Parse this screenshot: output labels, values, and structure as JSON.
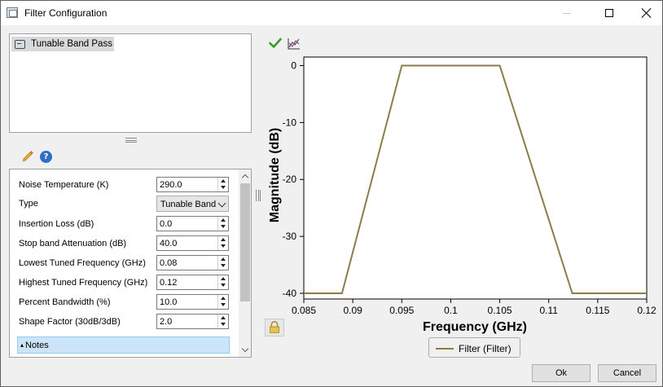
{
  "window": {
    "title": "Filter Configuration"
  },
  "filter_list": {
    "items": [
      {
        "label": "Tunable Band Pass",
        "icon": "filter-icon"
      }
    ]
  },
  "toolbar": {
    "edit_icon": "pencil-icon",
    "help_icon": "help-icon",
    "help_glyph": "?"
  },
  "properties": [
    {
      "label": "Noise Temperature (K)",
      "kind": "spin",
      "value": "290.0"
    },
    {
      "label": "Type",
      "kind": "combo",
      "value": "Tunable Band Pass"
    },
    {
      "label": "Insertion Loss (dB)",
      "kind": "spin",
      "value": "0.0"
    },
    {
      "label": "Stop band Attenuation (dB)",
      "kind": "spin",
      "value": "40.0"
    },
    {
      "label": "Lowest Tuned Frequency  (GHz)",
      "kind": "spin",
      "value": "0.08"
    },
    {
      "label": "Highest Tuned Frequency  (GHz)",
      "kind": "spin",
      "value": "0.12"
    },
    {
      "label": "Percent Bandwidth (%)",
      "kind": "spin",
      "value": "10.0"
    },
    {
      "label": "Shape Factor (30dB/3dB)",
      "kind": "spin",
      "value": "2.0"
    }
  ],
  "notes": {
    "label": "Notes",
    "caret": "▴"
  },
  "chart_toolbar": {
    "apply_icon": "checkmark-icon",
    "chart_tool_icon": "chart-settings-icon"
  },
  "chart_data": {
    "type": "line",
    "xlabel": "Frequency (GHz)",
    "ylabel": "Magnitude (dB)",
    "xlim": [
      0.085,
      0.12
    ],
    "ylim": [
      -41,
      1.5
    ],
    "xticks": [
      "0.085",
      "0.09",
      "0.095",
      "0.1",
      "0.105",
      "0.11",
      "0.115",
      "0.12"
    ],
    "yticks": [
      "0",
      "-10",
      "-20",
      "-30",
      "-40"
    ],
    "grid": false,
    "legend_position": "bottom",
    "series": [
      {
        "name": "Filter (Filter)",
        "color": "#8b7d48",
        "x": [
          0.085,
          0.0889,
          0.095,
          0.105,
          0.1124,
          0.12
        ],
        "y": [
          -40,
          -40,
          0,
          0,
          -40,
          -40
        ]
      }
    ]
  },
  "buttons": {
    "ok": "Ok",
    "cancel": "Cancel"
  }
}
